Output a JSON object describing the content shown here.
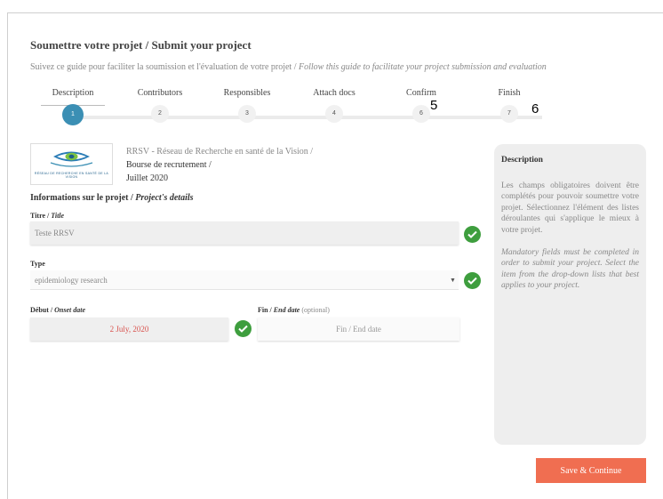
{
  "header": {
    "title": "Soumettre votre projet / Submit your project",
    "subtitle_fr": "Suivez ce guide pour faciliter la soumission et l'évaluation de votre projet / ",
    "subtitle_en": "Follow this guide to facilitate your project submission and evaluation"
  },
  "stepper": {
    "steps": [
      {
        "label": "Description",
        "number": "1"
      },
      {
        "label": "Contributors",
        "number": "2"
      },
      {
        "label": "Responsibles",
        "number": "3"
      },
      {
        "label": "Attach docs",
        "number": "4"
      },
      {
        "label": "Confirm",
        "number": "6"
      },
      {
        "label": "Finish",
        "number": "7"
      }
    ],
    "active_index": 0,
    "overlay_numbers": [
      "5",
      "6"
    ]
  },
  "organization": {
    "name": "RRSV - Réseau de Recherche en santé de la Vision /",
    "award": "Bourse de recrutement /",
    "date": "Juillet 2020",
    "logo_text": "RÉSEAU DE RECHERCHE EN SANTÉ DE LA VISION"
  },
  "section": {
    "title_fr": "Informations sur le projet / ",
    "title_en": "Project's details"
  },
  "fields": {
    "title_label_fr": "Titre / ",
    "title_label_en": "Title",
    "title_value": "Teste RRSV",
    "type_label": "Type",
    "type_value": "epidemiology research",
    "start_label_fr": "Début / ",
    "start_label_en": "Onset date",
    "start_value": "2 July, 2020",
    "end_label_fr": "Fin / ",
    "end_label_en": "End date",
    "end_label_optional": " (optional)",
    "end_placeholder": "Fin / End date"
  },
  "help": {
    "heading": "Description",
    "text_fr": "Les champs obligatoires doivent être complétés pour pouvoir soumettre votre projet. Sélectionnez l'élément des listes déroulantes qui s'applique le mieux à votre projet.",
    "text_en": "Mandatory fields must be completed in order to submit your project. Select the item from the drop-down lists that best applies to your project."
  },
  "actions": {
    "save_label": "Save & Continue"
  },
  "colors": {
    "accent": "#3b8fb4",
    "success": "#3e9e3e",
    "button": "#f06e51",
    "date_text": "#d9534f"
  }
}
